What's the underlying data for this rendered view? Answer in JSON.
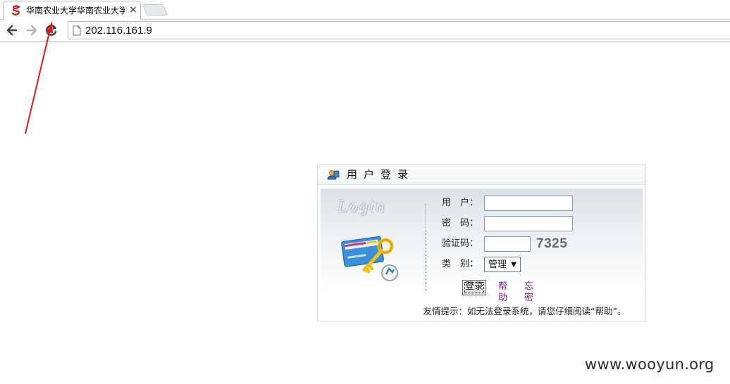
{
  "browser": {
    "tab": {
      "title": "华南农业大学华南农业大学",
      "close_glyph": "×",
      "favicon": "red-s-logo-icon"
    },
    "address": {
      "url": "202.116.161.9"
    },
    "nav": {
      "back": "back-arrow-icon",
      "forward": "forward-arrow-icon",
      "reload": "reload-icon"
    }
  },
  "login": {
    "title": "用户登录",
    "watermark_text": "Login",
    "fields": {
      "user_label": "用　户：",
      "password_label": "密　码：",
      "captcha_label": "验证码：",
      "captcha_code": "7325",
      "type_label": "类　别：",
      "type_selected": "管理"
    },
    "buttons": {
      "login": "登录",
      "help": "帮助",
      "forgot": "忘密"
    },
    "tip": "友情提示：如无法登录系统，请您仔细阅读“帮助”。"
  },
  "footer": {
    "watermark": "www.wooyun.org"
  },
  "colors": {
    "annotation_arrow": "#e0191f",
    "link": "#7a1f7a",
    "captcha": "#666d75"
  }
}
